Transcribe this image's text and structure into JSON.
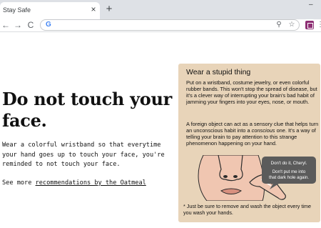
{
  "browser": {
    "tab_title": "Stay Safe",
    "tab_close_glyph": "×",
    "new_tab_glyph": "+",
    "minimize_glyph": "–",
    "back_glyph": "←",
    "forward_glyph": "→",
    "reload_glyph": "C",
    "google_glyph": "G",
    "url_value": "",
    "zoom_glyph": "⚲",
    "bookmark_glyph": "☆",
    "icons": [
      "close-icon",
      "plus-icon",
      "back-arrow-icon",
      "forward-arrow-icon",
      "reload-icon",
      "google-icon",
      "zoom-icon",
      "star-icon",
      "extension-icon"
    ]
  },
  "page": {
    "title": "Do not touch your face.",
    "body": "Wear a colorful wristband so that everytime\nyour hand goes up to touch your face, you're\nreminded to not touch your face.",
    "see_more_prefix": "See more ",
    "see_more_link": "recommendations by the Oatmeal"
  },
  "card": {
    "title": "Wear a stupid thing",
    "p1": "Put on a wristband, costume jewelry, or even colorful rubber bands. This won't stop the spread of disease, but it's a clever way of interrupting your brain's bad habit of jamming your fingers into your eyes, nose, or mouth.",
    "p2_a": "A foreign object can act as a sensory clue that helps turn an unconscious habit into a ",
    "p2_em": "conscious",
    "p2_b": " one. It's a way of telling your brain to pay attention to this strange phenomenon happening on your hand.",
    "bubble_1": "Don't do it, Cheryl.",
    "bubble_2": "Don't put me into",
    "bubble_3": "that dark hole again.",
    "note": "* Just be sure to remove and wash the object every time you wash your hands."
  },
  "colors": {
    "tab_strip": "#dee1e6",
    "card_background": "#e8d4b9",
    "speech_bubble": "#5b5b5b",
    "skin": "#f0c6b1",
    "extension": "#8e2f74"
  }
}
